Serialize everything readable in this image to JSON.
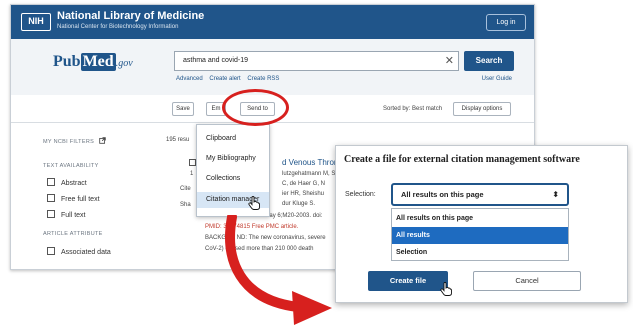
{
  "colors": {
    "nih_blue": "#20558a",
    "highlight_red": "#d7201e",
    "selected_blue": "#1e6bc0"
  },
  "header": {
    "logo_text": "NIH",
    "title": "National Library of Medicine",
    "subtitle": "National Center for Biotechnology Information",
    "login": "Log in"
  },
  "brand": {
    "pub": "Pub",
    "med": "Med",
    "gov": ".gov"
  },
  "search": {
    "query": "asthma and covid-19",
    "button": "Search",
    "links": [
      "Advanced",
      "Create alert",
      "Create RSS"
    ],
    "user_guide": "User Guide"
  },
  "toolbar": {
    "save": "Save",
    "email": "Em",
    "send_to": "Send to",
    "sorted_by": "Sorted by: Best match",
    "display_options": "Display options"
  },
  "filters": {
    "my_filters": "MY NCBI FILTERS",
    "text_availability": "TEXT AVAILABILITY",
    "items": [
      "Abstract",
      "Free full text",
      "Full text"
    ],
    "article_attribute": "ARTICLE ATTRIBUTE",
    "attr_items": [
      "Associated data"
    ]
  },
  "results": {
    "count": "195 resu",
    "lines": [
      "d Venous Thron",
      "lutzgehatmann M, S",
      "C, de Haer G, N",
      "ier HR, Sheishu",
      "dur Kluge S.",
      "Ann Intern Med. 2020 May 6;M20-2003. doi:",
      "PMID: 32374815    Free PMC article.",
      "BACKGRO   ND: The new coronavirus, severe",
      "CoV-2)  caused more than 210 000 death"
    ],
    "num": "1",
    "cite": "Cite",
    "share": "Sha"
  },
  "dropdown": {
    "items": [
      "Clipboard",
      "My Bibliography",
      "Collections",
      "Citation manager"
    ],
    "active_index": 3
  },
  "citation_dialog": {
    "title": "Create a file for external citation management software",
    "selection_label": "Selection:",
    "selected": "All results on this page",
    "options": [
      "All results on this page",
      "All results",
      "Selection"
    ],
    "highlighted_index": 1,
    "create": "Create file",
    "cancel": "Cancel"
  },
  "icons": {
    "external_link": "external-link-icon",
    "select_arrow": "up-down-arrow-icon",
    "cursor": "hand-cursor-icon",
    "clear": "clear-icon",
    "arrow": "red-curved-arrow"
  }
}
